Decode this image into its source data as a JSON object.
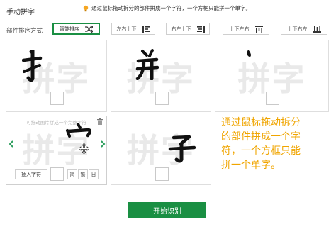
{
  "header": {
    "title": "手动拼字",
    "hint": "通过鼠标拖动拆分的部件拼成一个字符，一个方框只能拼一个单字。"
  },
  "sort": {
    "label": "部件排序方式",
    "options": [
      {
        "label": "智能排序",
        "icon": "shuffle-icon",
        "selected": true
      },
      {
        "label": "左右上下",
        "icon": "left-right-top-bottom-icon",
        "selected": false
      },
      {
        "label": "右左上下",
        "icon": "right-left-top-bottom-icon",
        "selected": false
      },
      {
        "label": "上下左右",
        "icon": "top-bottom-left-right-icon",
        "selected": false
      },
      {
        "label": "上下右左",
        "icon": "top-bottom-right-left-icon",
        "selected": false
      }
    ]
  },
  "grid": {
    "background_text": "拼字",
    "cells": [
      {
        "component": "扌",
        "checked": false
      },
      {
        "component": "廾",
        "checked": false
      },
      {
        "component": "丶",
        "checked": false
      },
      {
        "component": "宀",
        "checked": false,
        "active": true
      },
      {
        "component": "子",
        "checked": false
      }
    ],
    "active_cell": {
      "hint": "可拖动图片拼成一个完整字符",
      "insert_label": "插入字符",
      "mini_buttons": [
        "简",
        "繁",
        "日"
      ]
    }
  },
  "instruction": "通过鼠标拖动拆分的部件拼成一个字符，一个方框只能拼一个单字。",
  "actions": {
    "start_label": "开始识别"
  },
  "colors": {
    "accent": "#1a8f43",
    "instruction": "#f0a500",
    "background_text": "#e9e9e9"
  }
}
